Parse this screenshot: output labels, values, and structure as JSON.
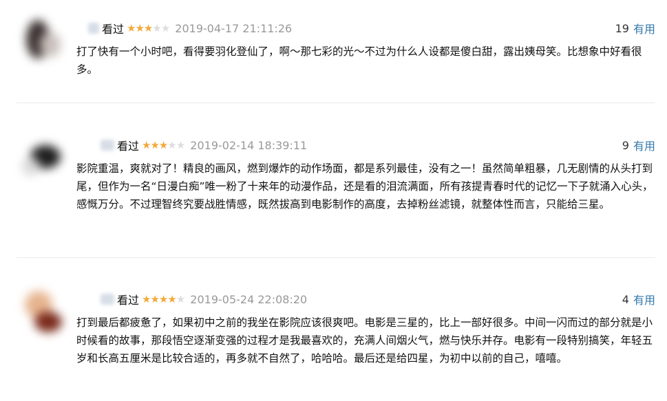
{
  "reviews": [
    {
      "watched": "看过",
      "rating": 3,
      "date": "2019-04-17 21:11:26",
      "votes": "19",
      "useful": "有用",
      "text": "打了快有一个小时吧，看得要羽化登仙了，啊～那七彩的光～不过为什么人设都是傻白甜，露出姨母笑。比想象中好看很多。"
    },
    {
      "watched": "看过",
      "rating": 3,
      "date": "2019-02-14 18:39:11",
      "votes": "9",
      "useful": "有用",
      "text": "影院重温，爽就对了！精良的画风，燃到爆炸的动作场面，都是系列最佳，没有之一！虽然简单粗暴，几无剧情的从头打到尾，但作为一名“日漫白痴”唯一粉了十来年的动漫作品，还是看的泪流满面，所有孩提青春时代的记忆一下子就涌入心头，感慨万分。不过理智终究要战胜情感，既然拔高到电影制作的高度，去掉粉丝滤镜，就整体性而言，只能给三星。"
    },
    {
      "watched": "看过",
      "rating": 4,
      "date": "2019-05-24 22:08:20",
      "votes": "4",
      "useful": "有用",
      "text": "打到最后都疲惫了，如果初中之前的我坐在影院应该很爽吧。电影是三星的，比上一部好很多。中间一闪而过的部分就是小时候看的故事，那段悟空逐渐变强的过程才是我最喜欢的，充满人间烟火气，燃与快乐并存。电影有一段特别搞笑，年轻五岁和长高五厘米是比较合适的，再多就不自然了，哈哈哈。最后还是给四星，为初中以前的自己，嘻嘻。"
    }
  ],
  "colors": {
    "star_on": "#f2a93b",
    "star_off": "#dddddd",
    "link": "#3377aa",
    "date": "#999999"
  },
  "icons": {
    "star": "star-icon"
  }
}
